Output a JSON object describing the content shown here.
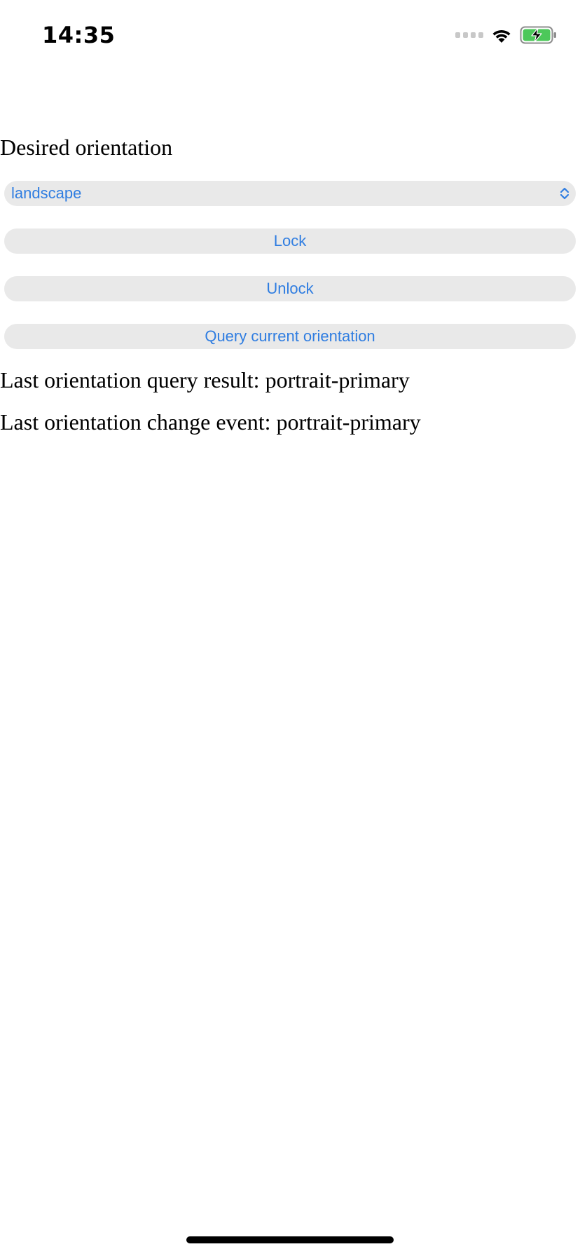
{
  "status_bar": {
    "time": "14:35",
    "icons": [
      "cellular-signal-icon",
      "wifi-icon",
      "battery-charging-icon"
    ],
    "battery_color": "#4cc85a"
  },
  "orientation_form": {
    "label": "Desired orientation",
    "select": {
      "selected_value": "landscape"
    },
    "lock_button_label": "Lock",
    "unlock_button_label": "Unlock",
    "query_button_label": "Query current orientation"
  },
  "results": {
    "last_query": "Last orientation query result: portrait-primary",
    "last_change_event": "Last orientation change event: portrait-primary"
  },
  "colors": {
    "accent": "#2f7de1",
    "control_background": "#e9e9e9",
    "text": "#000000"
  }
}
